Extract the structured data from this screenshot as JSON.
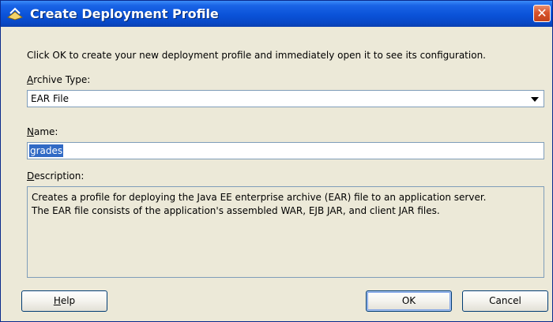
{
  "dialog": {
    "title": "Create Deployment Profile",
    "close_glyph": "✕"
  },
  "instructions": "Click OK to create your new deployment profile and immediately open it to see its configuration.",
  "archive_type": {
    "label_mnemonic": "A",
    "label_rest": "rchive Type:",
    "value": "EAR File"
  },
  "name": {
    "label_mnemonic": "N",
    "label_rest": "ame:",
    "value": "grades"
  },
  "description": {
    "label_mnemonic": "D",
    "label_rest": "escription:",
    "line1": "Creates a profile for deploying the Java EE enterprise archive (EAR) file to an application server.",
    "line2": "The EAR file consists of the application's assembled WAR, EJB JAR, and client JAR files."
  },
  "buttons": {
    "help_mnemonic": "H",
    "help_rest": "elp",
    "ok": "OK",
    "cancel": "Cancel"
  }
}
